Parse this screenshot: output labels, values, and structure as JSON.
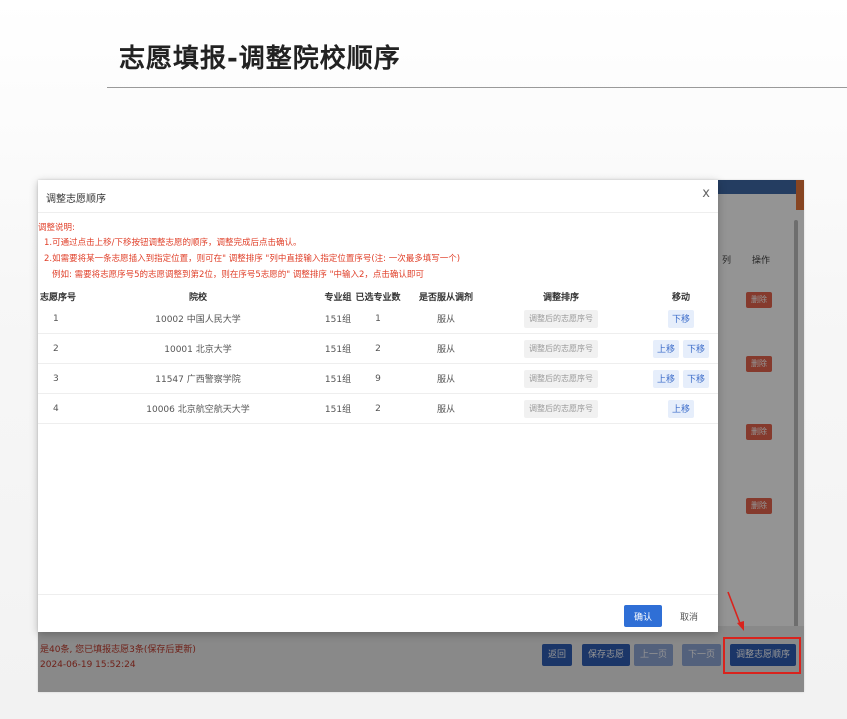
{
  "slide": {
    "title": "志愿填报-调整院校顺序"
  },
  "background_app": {
    "side_header": {
      "col1": "列",
      "col2": "操作"
    },
    "delete_label": "删除",
    "footer": {
      "info_line1": "是40条, 您已填报志愿3条(保存后更新)",
      "info_line2": "2024-06-19 15:52:24",
      "buttons": {
        "back": "返回",
        "save": "保存志愿",
        "prev": "上一页",
        "next": "下一页",
        "adjust_order": "调整志愿顺序"
      }
    }
  },
  "modal": {
    "title": "调整志愿顺序",
    "close": "x",
    "notes": [
      "调整说明:",
      "1.可通过点击上移/下移按钮调整志愿的顺序，调整完成后点击确认。",
      "2.如需要将某一条志愿插入到指定位置，则可在\" 调整排序 \"列中直接输入指定位置序号(注: 一次最多填写一个)",
      "例如: 需要将志愿序号5的志愿调整到第2位，则在序号5志愿的\" 调整排序 \"中输入2，点击确认即可"
    ],
    "columns": {
      "seq": "志愿序号",
      "school": "院校",
      "group": "专业组",
      "count": "已选专业数",
      "obey": "是否服从调剂",
      "adjust": "调整排序",
      "move": "移动"
    },
    "adjust_placeholder": "调整后的志愿序号",
    "move_up": "上移",
    "move_down": "下移",
    "rows": [
      {
        "seq": "1",
        "school": "10002 中国人民大学",
        "group": "151组",
        "count": "1",
        "obey": "服从"
      },
      {
        "seq": "2",
        "school": "10001 北京大学",
        "group": "151组",
        "count": "2",
        "obey": "服从"
      },
      {
        "seq": "3",
        "school": "11547 广西警察学院",
        "group": "151组",
        "count": "9",
        "obey": "服从"
      },
      {
        "seq": "4",
        "school": "10006 北京航空航天大学",
        "group": "151组",
        "count": "2",
        "obey": "服从"
      }
    ],
    "confirm": "确认",
    "cancel": "取消"
  },
  "colors": {
    "primary": "#2f6fd6",
    "note_red": "#e0402a",
    "delete_red": "#e5654f",
    "highlight_red": "#d9231d"
  }
}
